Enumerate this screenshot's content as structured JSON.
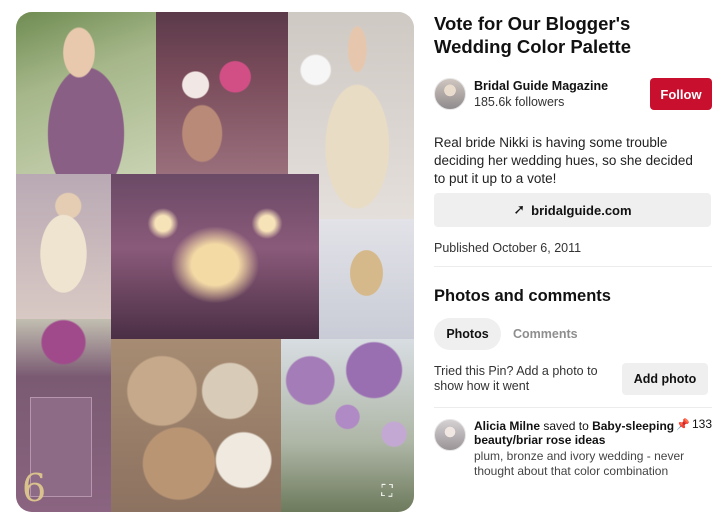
{
  "pin": {
    "title": "Vote for Our Blogger's Wedding Color Palette",
    "description": "Real bride Nikki is having some trouble deciding her wedding hues, so she decided to put it up to a vote!",
    "link_label": "bridalguide.com",
    "link_icon": "arrow-up-right-icon",
    "published": "Published October 6, 2011"
  },
  "creator": {
    "name": "Bridal Guide Magazine",
    "followers": "185.6k followers",
    "follow_label": "Follow"
  },
  "collage": {
    "invite_number": "6",
    "expand_icon": "expand-icon"
  },
  "comments_section": {
    "title": "Photos and comments",
    "tabs": [
      {
        "label": "Photos",
        "active": true
      },
      {
        "label": "Comments",
        "active": false
      }
    ],
    "tried_text": "Tried this Pin? Add a photo to show how it went",
    "add_photo_label": "Add photo"
  },
  "activity": {
    "user": "Alicia Milne",
    "saved_to": "saved to",
    "board": "Baby-sleeping beauty/briar rose ideas",
    "pin_count": "133",
    "comment": "plum, bronze and ivory wedding - never thought about that color combination"
  },
  "colors": {
    "follow_button": "#c8102e",
    "button_gray": "#efefef",
    "text_primary": "#111111"
  }
}
